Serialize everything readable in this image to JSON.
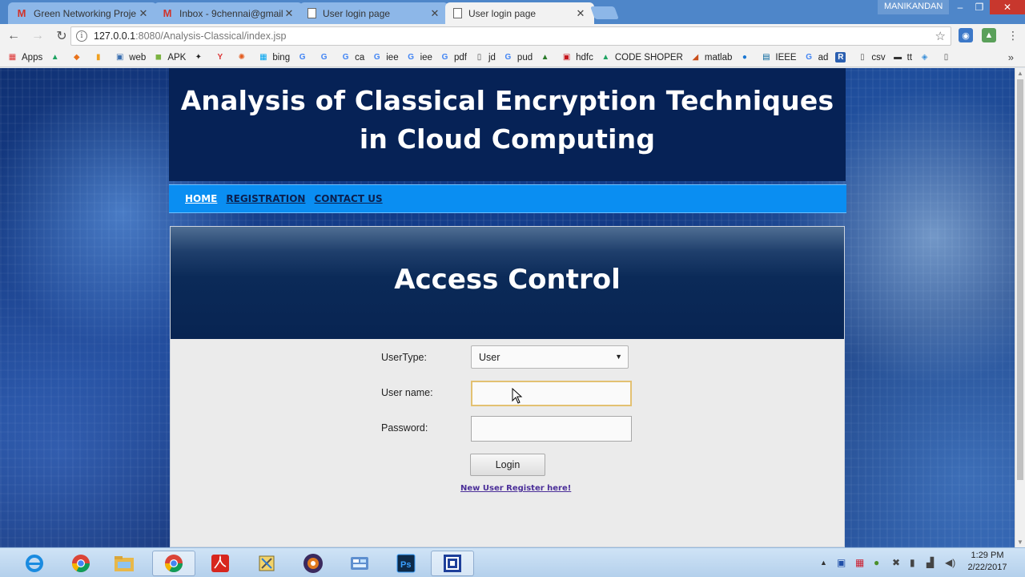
{
  "browser": {
    "tabs": [
      {
        "title": "Green Networking Proje",
        "icon": "gmail-icon",
        "active": false
      },
      {
        "title": "Inbox - 9chennai@gmail",
        "icon": "gmail-icon",
        "active": false
      },
      {
        "title": "User login page",
        "icon": "page-icon",
        "active": false
      },
      {
        "title": "User login page",
        "icon": "page-icon",
        "active": true
      }
    ],
    "profile": "MANIKANDAN",
    "url_host": "127.0.0.1",
    "url_path": ":8080/Analysis-Classical/index.jsp",
    "bookmarks": [
      "Apps",
      "",
      "",
      "",
      "web",
      "APK",
      "",
      "",
      "",
      "bing",
      "",
      "",
      "ca",
      "iee",
      "iee",
      "pdf",
      "jd",
      "pud",
      "",
      "hdfc",
      "CODE SHOPER",
      "matlab",
      "",
      "IEEE",
      "ad",
      "",
      "csv",
      "tt",
      "",
      ""
    ]
  },
  "page": {
    "title_line1": "Analysis of Classical Encryption Techniques",
    "title_line2": "in Cloud Computing",
    "nav": [
      {
        "label": "HOME",
        "current": true
      },
      {
        "label": "REGISTRATION",
        "current": false
      },
      {
        "label": "CONTACT US",
        "current": false
      }
    ],
    "panel_title": "Access Control",
    "form": {
      "usertype_label": "UserType:",
      "usertype_value": "User",
      "username_label": "User name:",
      "username_value": "",
      "password_label": "Password:",
      "password_value": "",
      "login_label": "Login",
      "register_link": "New User Register here!"
    }
  },
  "taskbar": {
    "apps": [
      "ie-icon",
      "chrome-icon",
      "explorer-icon",
      "chrome-icon",
      "acrobat-icon",
      "tools-icon",
      "java-ee-ide-icon",
      "control-panel-icon",
      "photoshop-icon",
      "app-icon"
    ],
    "active_index": 3,
    "time": "1:29 PM",
    "date": "2/22/2017"
  },
  "colors": {
    "header_bg": "#062256",
    "nav_bg": "#0a8ef2",
    "tabstrip": "#4e86c9"
  }
}
